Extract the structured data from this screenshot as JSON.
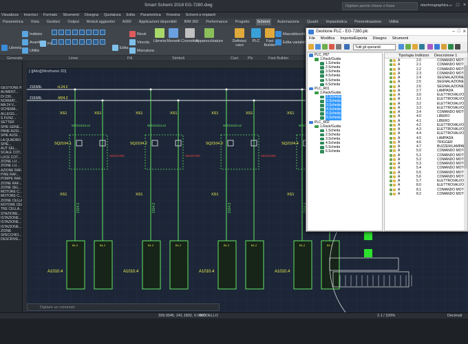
{
  "app": {
    "title": "Smart Schemi 2018   EG-7280.dwg",
    "search_placeholder": "Digitare parole chiave o frase",
    "user": "ntechnographics..."
  },
  "menu_row1": [
    "Visualizza",
    "Inserisci",
    "Formato",
    "Strumenti",
    "Disegna",
    "Quotatura",
    "Edita",
    "Parametrica",
    "Finestra",
    "Schemi e impianti"
  ],
  "menu_row2": [
    "Parametrica",
    "Vista",
    "Gestisci",
    "Output",
    "Moduli aggiuntivi",
    "A360",
    "Applicazioni disponibili",
    "BIM 360",
    "Performance",
    "Progetto",
    "Schemi",
    "Automazione",
    "Quadri",
    "Impiantistica",
    "Preventivazione",
    "Utilità"
  ],
  "active_tab": "Schemi",
  "ribbon": {
    "left_buttons": [
      "Libreria",
      "Indietro",
      "Avanti",
      "Utilità",
      "Filo"
    ],
    "mid_buttons": [
      "Edita",
      "Rinvii",
      "Vincola",
      "Marcatura",
      "Libreria",
      "Morsetti",
      "Connettori",
      "Apparecchiature",
      "Definisci cavo",
      "PLC",
      "Fast Builder",
      "Macroblocchi",
      "Edita variabili"
    ],
    "groups": [
      "Generale",
      "Linee",
      "Fili",
      "Simboli",
      "Cavi",
      "Plc",
      "Fast Builder"
    ]
  },
  "left_panel": {
    "items": [
      "GESTIONE P...",
      "ALIMENT...",
      "DI 230...",
      "NORMAT...",
      "MA 24 V...",
      "SCHEMA...",
      "ALLEGG...",
      "S FUNZ...",
      "SETTER",
      "",
      "SPIE GENE...",
      "PANE AUSI...",
      "SPIE AUSI...",
      "LA QUADRO",
      "",
      "SPIE...",
      "AUT SEL...",
      "SCALE COT...",
      "LUCE COT...",
      "ZIONE LU...",
      "ZIONE LU...",
      "AZIONE RAF...",
      "PINE RAF...",
      "POMPE RAF...",
      "ZIONE RAF...",
      "ZIONE SEL...",
      "MOTORE C...",
      "MOTORE C...",
      "ZIONE CELLA...",
      "NOTORE CELLA...",
      "TRE CELLA...",
      "STAZIONE...",
      "ISTAZIONE...",
      "ISTAZIONE...",
      "ISTAZIONE...",
      "ZIONE",
      "",
      "SPECCHIO...",
      "DESCRIVE..."
    ]
  },
  "drawing": {
    "viewport_label": "[-][Alto][Wireframe 2D]",
    "bus": [
      {
        "label": "2103/6L",
        "value": "+L24.2"
      },
      {
        "label": "2103/6L",
        "value": "-M24.2"
      }
    ],
    "columns": [
      {
        "ref": "SQ2104.1",
        "xs": "XS1",
        "wire": "2104.1",
        "box": "A1010.4",
        "code": "B1.2"
      },
      {
        "ref": "SQ2104.2",
        "xs": "XS1",
        "wire": "2104.2",
        "box": "A1010.4",
        "code": "B1.2"
      },
      {
        "ref": "SQ2104.3",
        "xs": "XS1",
        "wire": "2104.3",
        "box": "A1010.4",
        "code": "B1.2"
      },
      {
        "ref": "SQ2104.4",
        "xs": "XS1",
        "wire": "2104.4",
        "box": "A1010.4",
        "code": "B1.2"
      }
    ],
    "wire_label": "WRG2104.x2",
    "red_labels": [
      "SENSORE",
      "SENSORE",
      "SENSORE",
      "SENSORE"
    ]
  },
  "command_placeholder": "Digitare un comando",
  "status": {
    "coords": "339.9045, 241.1802, 0.0000",
    "mode": "MODELLO",
    "scale": "1:1 / 100%",
    "units": "Decimali"
  },
  "dialog": {
    "title": "Gestione PLC - EG-7280.plc",
    "menu": [
      "File",
      "Modifica",
      "Importa/Esporta",
      "Disegno",
      "Strumenti"
    ],
    "filter": "Tutti gli operandi",
    "tree": [
      {
        "level": 0,
        "label": "PLC_P87"
      },
      {
        "level": 1,
        "label": "1.Rack/Guida"
      },
      {
        "level": 2,
        "label": "1.Scheda"
      },
      {
        "level": 2,
        "label": "2.Scheda"
      },
      {
        "level": 2,
        "label": "3.Scheda"
      },
      {
        "level": 2,
        "label": "4.Scheda"
      },
      {
        "level": 2,
        "label": "5.Scheda"
      },
      {
        "level": 2,
        "label": "6.Scheda"
      },
      {
        "level": 0,
        "label": "PLC_R01"
      },
      {
        "level": 1,
        "label": "1.Rack/Guida"
      },
      {
        "level": 2,
        "label": "1.Scheda",
        "sel": true
      },
      {
        "level": 2,
        "label": "2.Scheda",
        "sel": true
      },
      {
        "level": 2,
        "label": "3.Scheda",
        "sel": true
      },
      {
        "level": 2,
        "label": "4.Scheda",
        "sel": true
      },
      {
        "level": 2,
        "label": "5.Scheda",
        "sel": true
      },
      {
        "level": 2,
        "label": "6.Scheda",
        "sel": true
      },
      {
        "level": 0,
        "label": "PLC_R02"
      },
      {
        "level": 1,
        "label": "1.Rack/Guida"
      },
      {
        "level": 2,
        "label": "1.Scheda"
      },
      {
        "level": 2,
        "label": "2.Scheda"
      },
      {
        "level": 2,
        "label": "3.Scheda"
      },
      {
        "level": 2,
        "label": "4.Scheda"
      },
      {
        "level": 2,
        "label": "5.Scheda"
      },
      {
        "level": 2,
        "label": "6.Scheda"
      }
    ],
    "columns": [
      "Tipologia",
      "Indirizzo",
      "Descrizione 1"
    ],
    "rows": [
      [
        "A",
        "2.0",
        "COMANDO MOTORE"
      ],
      [
        "A",
        "2.1",
        "COMANDO MOTORE"
      ],
      [
        "A",
        "2.2",
        "COMANDO MOTORE"
      ],
      [
        "A",
        "2.3",
        "COMANDO MOTORE"
      ],
      [
        "A",
        "2.4",
        "SEGNALAZIONE AUSILI"
      ],
      [
        "A",
        "2.5",
        "SEGNALAZIONE LUMIN"
      ],
      [
        "A",
        "2.6",
        "SEGNALAZIONE LUMIN"
      ],
      [
        "A",
        "2.7",
        "LAMPADA"
      ],
      [
        "A",
        "3.0",
        "ELETTROVALVOLA"
      ],
      [
        "A",
        "3.1",
        "ELETTROVALVOLA"
      ],
      [
        "A",
        "3.2",
        "ELETTROVALVOLA"
      ],
      [
        "A",
        "3.3",
        "ELETTROVALVOLA"
      ],
      [
        "A",
        "3.4",
        "COMANDO MOTORE"
      ],
      [
        "A",
        "4.0",
        "LIBERO"
      ],
      [
        "A",
        "4.1",
        "LIBERO"
      ],
      [
        "A",
        "4.2",
        "ELETTROVALVOLA"
      ],
      [
        "A",
        "4.3",
        "ELETTROVALVOLA"
      ],
      [
        "A",
        "4.4",
        "ELETTROVALVOLA"
      ],
      [
        "A",
        "4.5",
        "LAMPADA"
      ],
      [
        "A",
        "4.6",
        "TRIGGER"
      ],
      [
        "A",
        "4.7",
        "BUZZER/LAMPADA"
      ],
      [
        "A",
        "5.0",
        "COMANDO MOTORE"
      ],
      [
        "A",
        "5.1",
        "COMANDO MOTORE"
      ],
      [
        "A",
        "5.2",
        "COMANDO MOTORE"
      ],
      [
        "A",
        "5.3",
        "COMANDO MOTORE"
      ],
      [
        "A",
        "5.4",
        "COMANDO MOTORE"
      ],
      [
        "A",
        "5.5",
        "COMANDO MOTORE"
      ],
      [
        "A",
        "5.6",
        "COMANDO MOTORE"
      ],
      [
        "A",
        "5.7",
        "ELETTROVALVOLA"
      ],
      [
        "A",
        "8.0",
        "ELETTROVALVOLA"
      ],
      [
        "A",
        "8.1",
        "COMANDO MOTORE"
      ],
      [
        "A",
        "8.2",
        "COMANDO MOTORE"
      ]
    ]
  }
}
